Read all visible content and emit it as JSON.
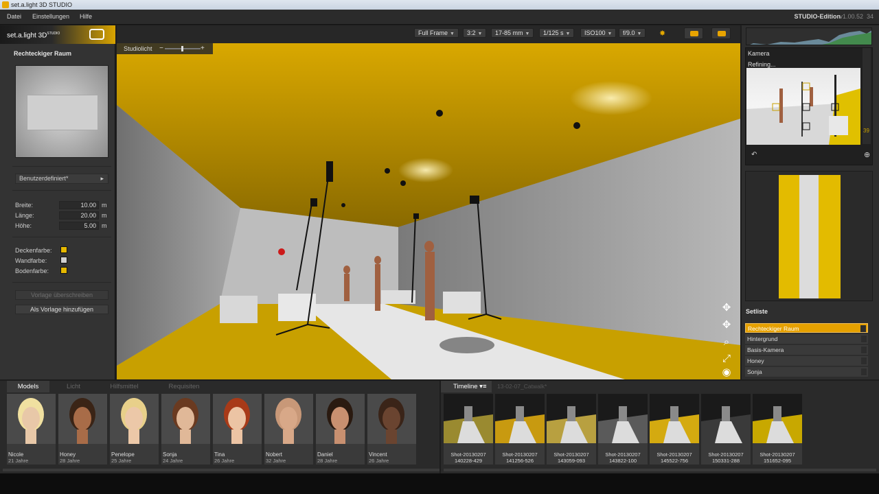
{
  "window": {
    "title": "set.a.light 3D STUDIO"
  },
  "menu": {
    "items": [
      "Datei",
      "Einstellungen",
      "Hilfe"
    ],
    "edition": "STUDIO-Edition",
    "version": "v1.00.52",
    "version_suffix": "34"
  },
  "logo": {
    "text": "set.a.light 3D",
    "superscript": "STUDIO"
  },
  "left_panel": {
    "title": "Rechteckiger Raum",
    "preset": "Benutzerdefiniert*",
    "fields": [
      {
        "label": "Breite:",
        "value": "10.00",
        "unit": "m"
      },
      {
        "label": "Länge:",
        "value": "20.00",
        "unit": "m"
      },
      {
        "label": "Höhe:",
        "value": "5.00",
        "unit": "m"
      }
    ],
    "colors": [
      {
        "label": "Deckenfarbe:",
        "color": "#e5b800"
      },
      {
        "label": "Wandfarbe:",
        "color": "#d0d0d0"
      },
      {
        "label": "Bodenfarbe:",
        "color": "#e5b800"
      }
    ],
    "btn_overwrite": "Vorlage überschreiben",
    "btn_add": "Als Vorlage hinzufügen"
  },
  "camera_toolbar": {
    "format": "Full Frame",
    "ratio": "3:2",
    "lens": "17-85 mm",
    "shutter": "1/125 s",
    "iso": "ISO100",
    "aperture": "f/9.0"
  },
  "viewport": {
    "studiolicht_label": "Studiolicht",
    "minus": "−",
    "plus": "+"
  },
  "camera_panel": {
    "label": "Kamera",
    "status": "Refining...",
    "slider_value": "39"
  },
  "setliste": {
    "title": "Setliste",
    "items": [
      "Rechteckiger Raum",
      "Hintergrund",
      "Basis-Kamera",
      "Honey",
      "Sonja"
    ],
    "selected_index": 0
  },
  "library": {
    "tabs": [
      "Models",
      "Licht",
      "Hilfsmittel",
      "Requisiten"
    ],
    "active_tab": "Models",
    "models": [
      {
        "name": "Nicole",
        "age": "21 Jahre",
        "skin": "#e8c8a8",
        "hair": "#f0e0a0"
      },
      {
        "name": "Honey",
        "age": "28 Jahre",
        "skin": "#a86c48",
        "hair": "#3a2416"
      },
      {
        "name": "Penelope",
        "age": "25 Jahre",
        "skin": "#ecc8a8",
        "hair": "#e8d08a"
      },
      {
        "name": "Sonja",
        "age": "24 Jahre",
        "skin": "#e0b898",
        "hair": "#6a3a20"
      },
      {
        "name": "Tina",
        "age": "26 Jahre",
        "skin": "#ecc4a4",
        "hair": "#a83a18"
      },
      {
        "name": "Nobert",
        "age": "32 Jahre",
        "skin": "#d8a888",
        "hair": "#c89878"
      },
      {
        "name": "Daniel",
        "age": "28 Jahre",
        "skin": "#c89070",
        "hair": "#2a1a10"
      },
      {
        "name": "Vincent",
        "age": "26 Jahre",
        "skin": "#6a4430",
        "hair": "#3a2418"
      }
    ]
  },
  "timeline": {
    "tab": "Timeline",
    "subtitle": "13-02-07_Catwalk*",
    "shots": [
      {
        "name": "Shot-20130207",
        "time": "140228-429",
        "floor": "#9a8a30"
      },
      {
        "name": "Shot-20130207",
        "time": "141256-526",
        "floor": "#c89a10"
      },
      {
        "name": "Shot-20130207",
        "time": "143059-093",
        "floor": "#b8a040"
      },
      {
        "name": "Shot-20130207",
        "time": "143822-100",
        "floor": "#5a5a5a"
      },
      {
        "name": "Shot-20130207",
        "time": "145522-756",
        "floor": "#d4aa10"
      },
      {
        "name": "Shot-20130207",
        "time": "150331-288",
        "floor": "#3a3a3a"
      },
      {
        "name": "Shot-20130207",
        "time": "151652-095",
        "floor": "#c8a800"
      }
    ]
  }
}
